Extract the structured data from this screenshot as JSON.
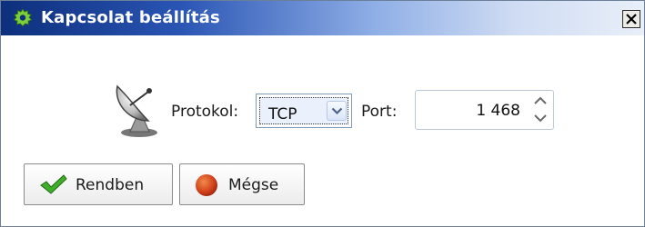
{
  "window": {
    "title": "Kapcsolat beállítás",
    "title_icon": "gear-icon",
    "close_icon": "close-icon"
  },
  "connection": {
    "icon": "satellite-dish-icon",
    "protocol_label": "Protokol:",
    "protocol_value": "TCP",
    "port_label": "Port:",
    "port_value": "1 468"
  },
  "buttons": {
    "ok_label": "Rendben",
    "ok_icon": "checkmark-icon",
    "cancel_label": "Mégse",
    "cancel_icon": "red-circle-icon"
  },
  "colors": {
    "titlebar_start": "#0d2f7c",
    "titlebar_end": "#e9eff9",
    "ok_green": "#3fae2a",
    "cancel_red": "#d2421b"
  }
}
